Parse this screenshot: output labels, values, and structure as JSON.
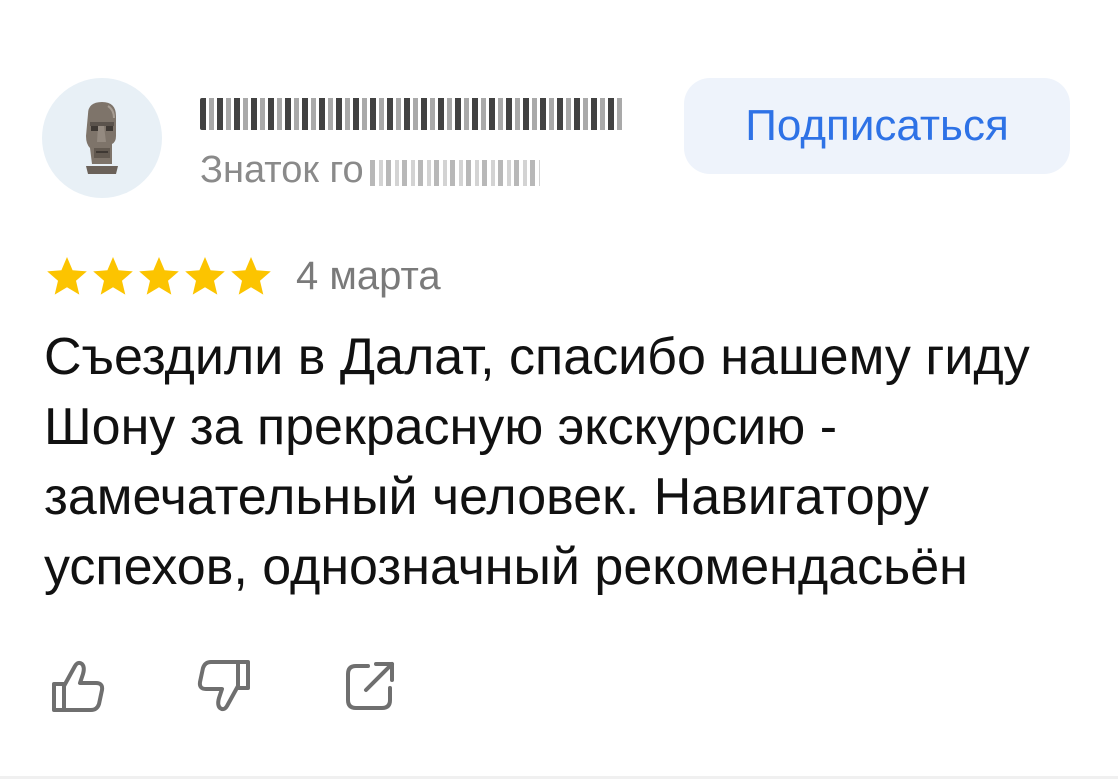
{
  "author": {
    "name": "",
    "subtitle_visible": "Знаток го",
    "avatar_icon": "moai-statue-icon"
  },
  "subscribe_button": {
    "label": "Подписаться",
    "color": "#2e72e6"
  },
  "rating": {
    "stars": 5,
    "max": 5,
    "star_color": "#fcc400",
    "date": "4 марта"
  },
  "review": {
    "text": "Съездили в Далат, спасибо нашему гиду Шону за прекрасную экскурсию - замечательный человек. Навигатору успехов, однозначный рекомендасьён"
  },
  "actions": [
    {
      "icon": "thumbs-up-icon"
    },
    {
      "icon": "thumbs-down-icon"
    },
    {
      "icon": "share-icon"
    }
  ]
}
